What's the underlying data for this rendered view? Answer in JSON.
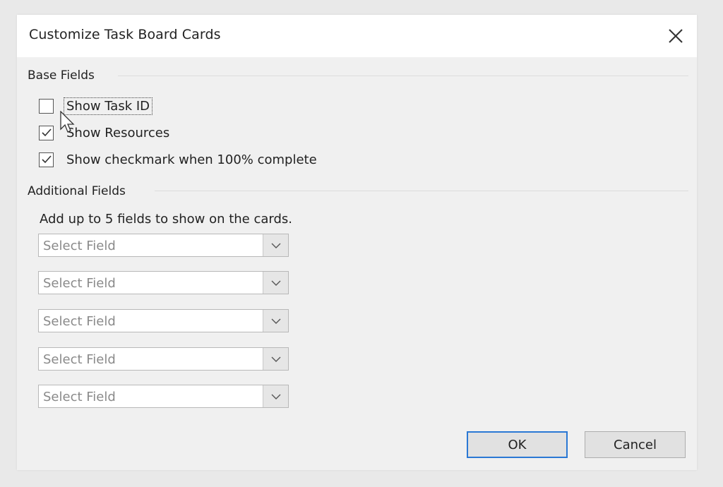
{
  "dialog": {
    "title": "Customize Task Board Cards",
    "close_icon": "close-x-icon"
  },
  "base_fields": {
    "label": "Base Fields",
    "options": [
      {
        "label": "Show Task ID",
        "checked": false,
        "focused": true
      },
      {
        "label": "Show Resources",
        "checked": true,
        "focused": false
      },
      {
        "label": "Show checkmark when 100% complete",
        "checked": true,
        "focused": false
      }
    ]
  },
  "additional_fields": {
    "label": "Additional Fields",
    "hint": "Add up to 5 fields to show on the cards.",
    "selects": [
      {
        "value": "Select Field"
      },
      {
        "value": "Select Field"
      },
      {
        "value": "Select Field"
      },
      {
        "value": "Select Field"
      },
      {
        "value": "Select Field"
      }
    ]
  },
  "buttons": {
    "ok": "OK",
    "cancel": "Cancel"
  },
  "colors": {
    "default_button_border": "#2a78d4",
    "dialog_bg": "#f0f0f0",
    "titlebar_bg": "#ffffff"
  }
}
